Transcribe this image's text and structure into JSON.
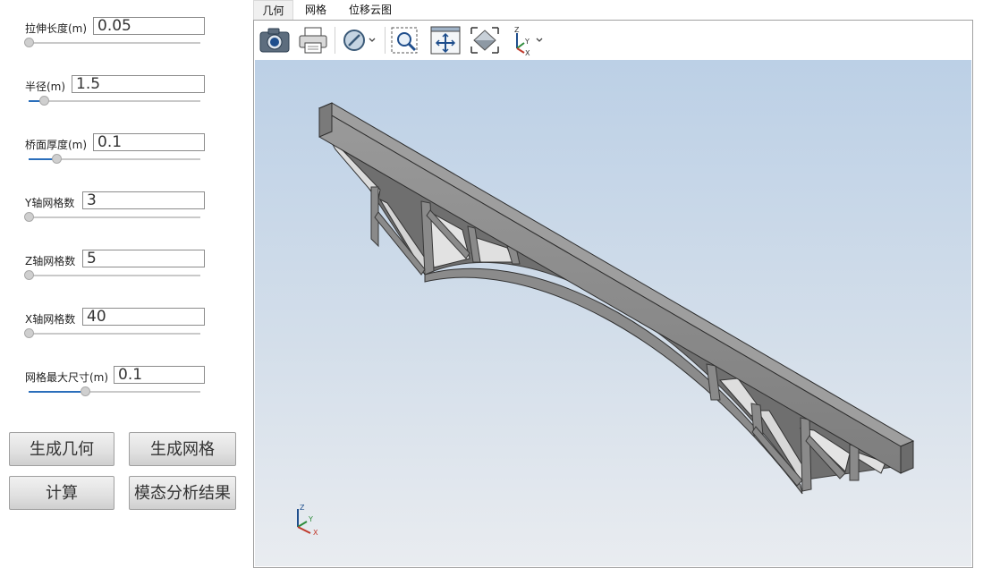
{
  "params": [
    {
      "label": "拉伸长度(m)",
      "value": "0.05",
      "slider_fraction": 0.0
    },
    {
      "label": "半径(m)",
      "value": "1.5",
      "slider_fraction": 0.09
    },
    {
      "label": "桥面厚度(m)",
      "value": "0.1",
      "slider_fraction": 0.16
    },
    {
      "label": "Y轴网格数",
      "value": "3",
      "slider_fraction": 0.0
    },
    {
      "label": "Z轴网格数",
      "value": "5",
      "slider_fraction": 0.0
    },
    {
      "label": "X轴网格数",
      "value": "40",
      "slider_fraction": 0.0
    },
    {
      "label": "网格最大尺寸(m)",
      "value": "0.1",
      "slider_fraction": 0.33
    }
  ],
  "buttons": {
    "generate_geometry": "生成几何",
    "generate_mesh": "生成网格",
    "compute": "计算",
    "modal_results": "模态分析结果"
  },
  "tabs": [
    "几何",
    "网格",
    "位移云图"
  ],
  "active_tab": "几何",
  "toolbar": {
    "icons": [
      "camera-icon",
      "print-icon",
      "display-mode-icon",
      "zoom-window-icon",
      "pan-icon",
      "fit-all-icon",
      "axes-view-icon"
    ]
  },
  "axis_labels": {
    "z": "Z",
    "y": "Y",
    "x": "X"
  },
  "colors": {
    "accent": "#2a6ebb",
    "viewport_top": "#bcd0e6",
    "viewport_bottom": "#e9ecf0",
    "model": "#8a8a8a"
  }
}
